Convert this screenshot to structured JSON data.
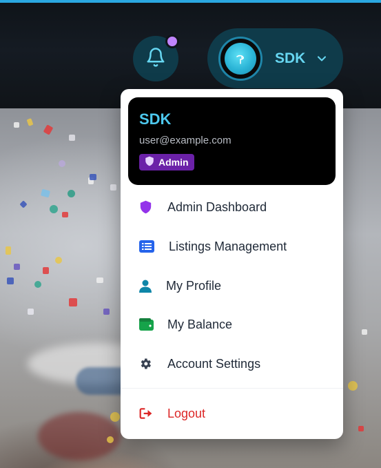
{
  "header": {
    "user": {
      "name": "SDK"
    },
    "notifications": {
      "has_unread": true
    }
  },
  "dropdown": {
    "profile": {
      "name": "SDK",
      "email": "user@example.com",
      "role": "Admin"
    },
    "items": [
      {
        "label": "Admin Dashboard",
        "icon": "shield-icon",
        "color": "#9333ea"
      },
      {
        "label": "Listings Management",
        "icon": "list-icon",
        "color": "#2563eb"
      },
      {
        "label": "My Profile",
        "icon": "user-icon",
        "color": "#0e86a8"
      },
      {
        "label": "My Balance",
        "icon": "wallet-icon",
        "color": "#16a34a"
      },
      {
        "label": "Account Settings",
        "icon": "gear-icon",
        "color": "#374151"
      }
    ],
    "logout": {
      "label": "Logout",
      "icon": "logout-icon",
      "color": "#dc2626"
    }
  }
}
